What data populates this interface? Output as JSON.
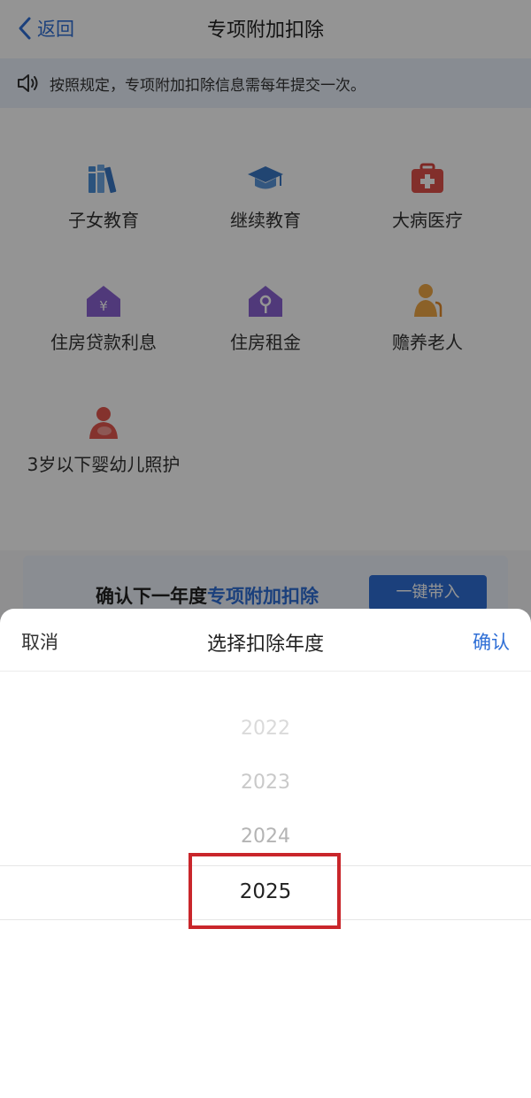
{
  "header": {
    "back_label": "返回",
    "title": "专项附加扣除"
  },
  "notice": {
    "text": "按照规定，专项附加扣除信息需每年提交一次。"
  },
  "grid": {
    "items": [
      {
        "label": "子女教育",
        "icon": "books-icon"
      },
      {
        "label": "继续教育",
        "icon": "graduation-cap-icon"
      },
      {
        "label": "大病医疗",
        "icon": "medical-kit-icon"
      },
      {
        "label": "住房贷款利息",
        "icon": "house-loan-icon"
      },
      {
        "label": "住房租金",
        "icon": "house-key-icon"
      },
      {
        "label": "赡养老人",
        "icon": "elderly-person-icon"
      },
      {
        "label": "3岁以下婴幼儿照护",
        "icon": "mother-baby-icon"
      }
    ]
  },
  "confirm_card": {
    "text_prefix": "确认下一年度",
    "text_highlight": "专项附加扣除",
    "button_label": "一键带入"
  },
  "sheet": {
    "cancel_label": "取消",
    "title": "选择扣除年度",
    "confirm_label": "确认",
    "options": [
      "2022",
      "2023",
      "2024",
      "2025"
    ],
    "selected": "2025"
  },
  "colors": {
    "accent": "#2f6fd6",
    "highlight_box": "#c9262b"
  }
}
